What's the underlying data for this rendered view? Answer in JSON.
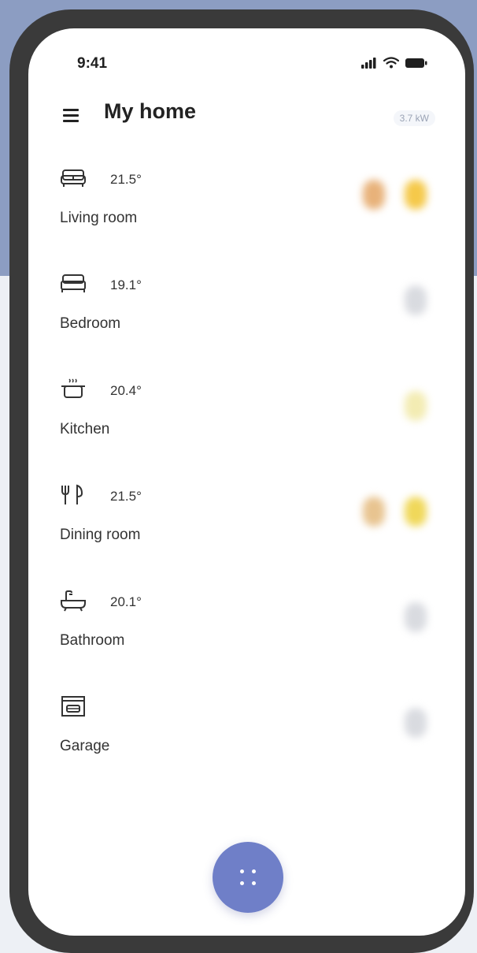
{
  "status_bar": {
    "time": "9:41",
    "icons": [
      "signal-icon",
      "wifi-icon",
      "battery-icon"
    ]
  },
  "header": {
    "title": "My home",
    "power": "3.7 kW",
    "menu_icon": "menu-icon"
  },
  "rooms": [
    {
      "name": "Living room",
      "temperature": "21.5°",
      "icon": "sofa-icon",
      "devices": [
        "heater",
        "light-on"
      ]
    },
    {
      "name": "Bedroom",
      "temperature": "19.1°",
      "icon": "bed-icon",
      "devices": [
        "light-off"
      ]
    },
    {
      "name": "Kitchen",
      "temperature": "20.4°",
      "icon": "pot-icon",
      "devices": [
        "light-dim"
      ]
    },
    {
      "name": "Dining room",
      "temperature": "21.5°",
      "icon": "cutlery-icon",
      "devices": [
        "heater",
        "light-on"
      ]
    },
    {
      "name": "Bathroom",
      "temperature": "20.1°",
      "icon": "bathtub-icon",
      "devices": [
        "light-off"
      ]
    },
    {
      "name": "Garage",
      "temperature": "",
      "icon": "garage-icon",
      "devices": [
        "light-off"
      ]
    }
  ],
  "colors": {
    "accent": "#6f7fc8",
    "background_panel": "#8c9dc2",
    "light_on": "#f5c94a",
    "heater": "#e8b27a",
    "light_off": "#d9dbe0"
  },
  "fab": {
    "icon": "grid-dots-icon"
  }
}
